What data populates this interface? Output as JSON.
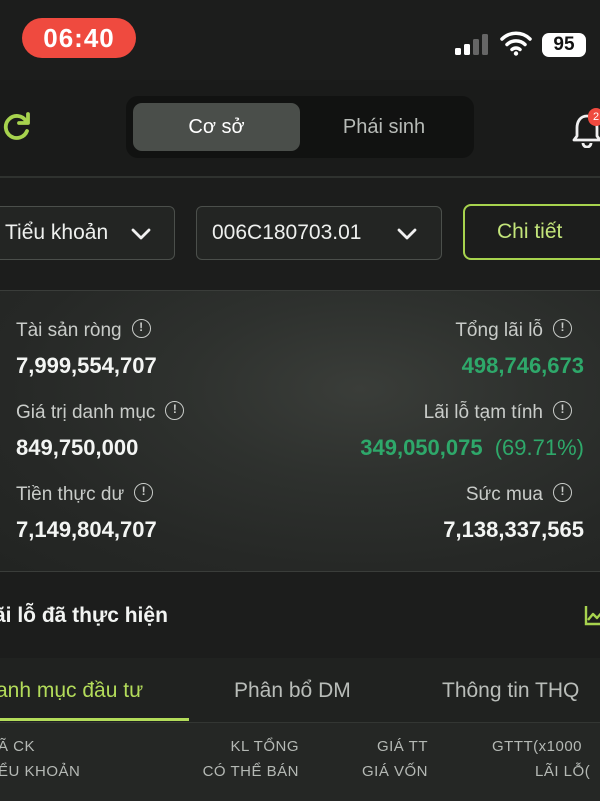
{
  "status_bar": {
    "time": "06:40",
    "battery": "95"
  },
  "header": {
    "segments": [
      {
        "label": "Cơ sở",
        "active": true
      },
      {
        "label": "Phái sinh",
        "active": false
      }
    ],
    "notification_badge": "2"
  },
  "selectors": {
    "account_type": "Tiểu khoản",
    "account_number": "006C180703.01",
    "detail_button": "Chi tiết"
  },
  "summary": {
    "net_assets": {
      "label": "Tài sản ròng",
      "value": "7,999,554,707"
    },
    "total_pnl": {
      "label": "Tổng lãi lỗ",
      "value": "498,746,673"
    },
    "portfolio_value": {
      "label": "Giá trị danh mục",
      "value": "849,750,000"
    },
    "provisional_pnl": {
      "label": "Lãi lỗ tạm tính",
      "value": "349,050,075",
      "percent": "(69.71%)"
    },
    "actual_cash": {
      "label": "Tiền thực dư",
      "value": "7,149,804,707"
    },
    "purchasing_power": {
      "label": "Sức mua",
      "value": "7,138,337,565"
    }
  },
  "realized": {
    "title": "ãi lỗ đã thực hiện"
  },
  "tabs": [
    "anh mục đầu tư",
    "Phân bổ DM",
    "Thông tin THQ"
  ],
  "table_header": {
    "col1": [
      "Ã CK",
      "ỂU KHOẢN"
    ],
    "col2": [
      "KL TỔNG",
      "CÓ THỂ BÁN"
    ],
    "col3": [
      "GIÁ TT",
      "GIÁ VỐN"
    ],
    "col4": [
      "GTTT(x1000",
      "LÃI LỖ("
    ]
  },
  "colors": {
    "accent": "#a7d34e",
    "positive": "#2ea86a",
    "alert": "#ef4a3f"
  }
}
